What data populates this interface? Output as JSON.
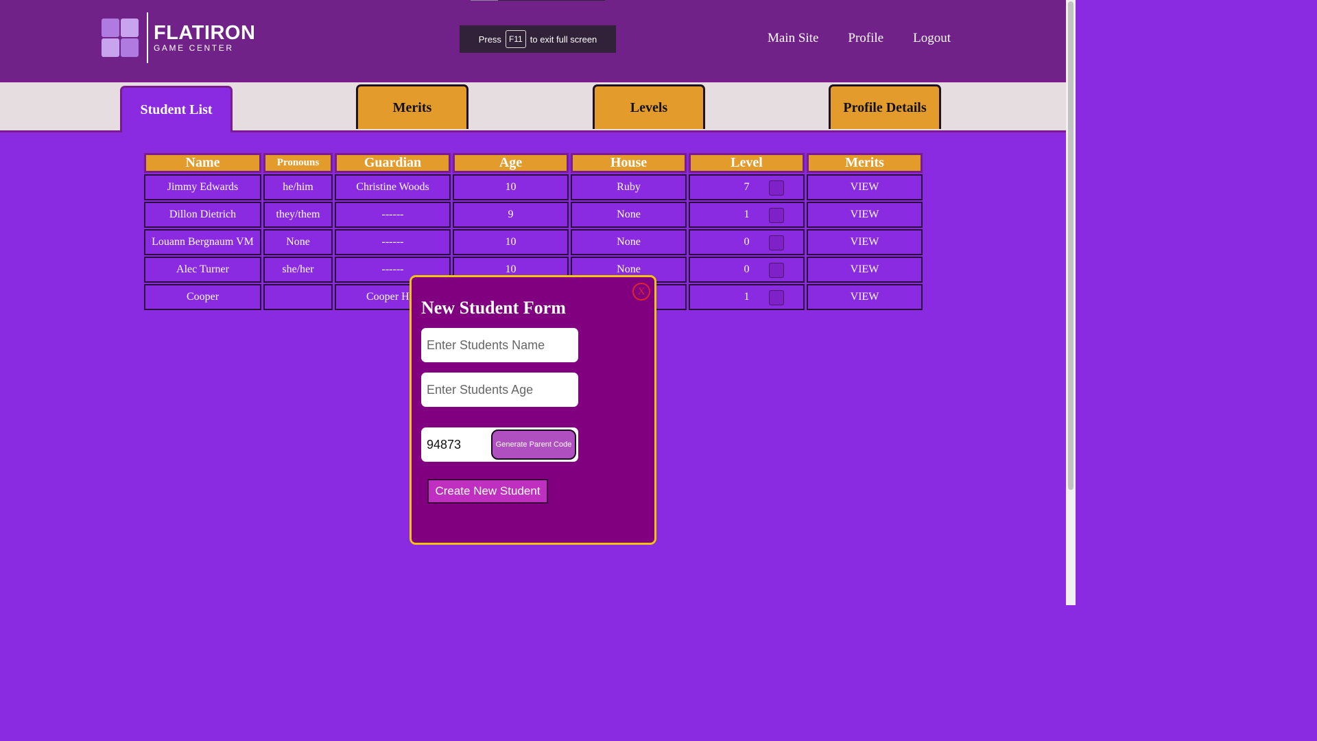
{
  "header": {
    "logo_title": "FLATIRON",
    "logo_subtitle": "GAME CENTER",
    "fullscreen_prefix": "Press",
    "fullscreen_key": "F11",
    "fullscreen_suffix": "to exit full screen",
    "nav": [
      "Main Site",
      "Profile",
      "Logout"
    ]
  },
  "tabs": [
    "Student List",
    "Merits",
    "Levels",
    "Profile Details"
  ],
  "active_tab": "Student List",
  "table": {
    "columns": [
      "Name",
      "Pronouns",
      "Guardian",
      "Age",
      "House",
      "Level",
      "Merits"
    ],
    "rows": [
      [
        "Jimmy Edwards",
        "he/him",
        "Christine Woods",
        "10",
        "Ruby",
        "7",
        "VIEW"
      ],
      [
        "Dillon Dietrich",
        "they/them",
        "------",
        "9",
        "None",
        "1",
        "VIEW"
      ],
      [
        "Louann Bergnaum VM",
        "None",
        "------",
        "10",
        "None",
        "0",
        "VIEW"
      ],
      [
        "Alec Turner",
        "she/her",
        "------",
        "10",
        "None",
        "0",
        "VIEW"
      ],
      [
        "Cooper",
        "",
        "Cooper Ha",
        "",
        "",
        "1",
        "VIEW"
      ]
    ]
  },
  "modal": {
    "close_label": "X",
    "title": "New Student Form",
    "name_placeholder": "Enter Students Name",
    "age_placeholder": "Enter Students Age",
    "parent_code_value": "94873",
    "generate_label": "Generate Parent Code",
    "create_label": "Create New Student"
  },
  "colors": {
    "page_bg": "#8a2be2",
    "header_bg": "#712289",
    "tab_orange": "#e39b2b",
    "modal_bg": "#800080",
    "modal_border": "#f1c40f"
  }
}
